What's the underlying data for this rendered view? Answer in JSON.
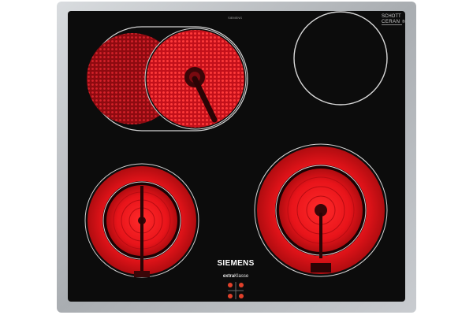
{
  "appliance": {
    "type": "ceramic-hob",
    "frame_color": "#b9bcbf",
    "glass_color": "#0c0c0c",
    "heat_color": "#e8141a",
    "ring_outline_color": "#d2d2d2"
  },
  "top_brand_text": "SIEMENS",
  "certification_badge": {
    "line1": "SCHOTT",
    "line2": "CERAN",
    "line3": "®"
  },
  "branding": {
    "logo_text": "SIEMENS",
    "series_prefix": "extra",
    "series_suffix": "Klasse"
  },
  "zones": [
    {
      "id": "rear-left",
      "kind": "dual-oval",
      "state": "on"
    },
    {
      "id": "rear-right",
      "kind": "single",
      "state": "off"
    },
    {
      "id": "front-left",
      "kind": "dual-circuit",
      "state": "on"
    },
    {
      "id": "front-right",
      "kind": "dual-circuit",
      "state": "on"
    }
  ],
  "controls": {
    "indicator_lights": 4,
    "indicator_color": "#e0402a"
  }
}
